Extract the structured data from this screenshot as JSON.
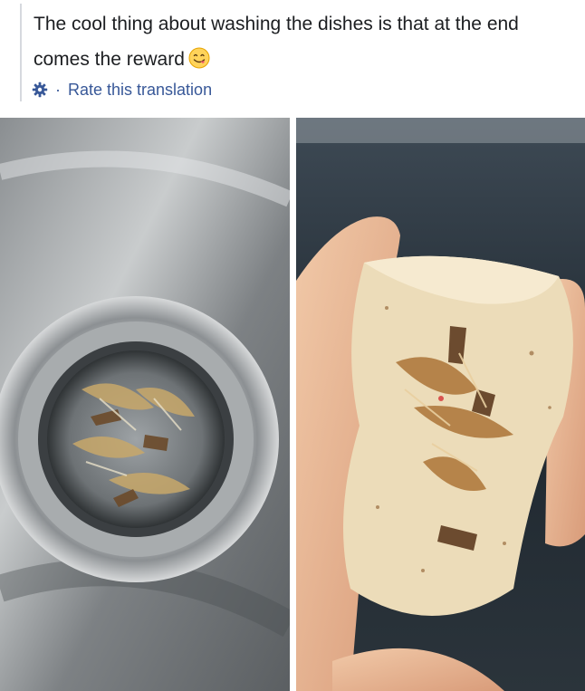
{
  "post": {
    "text": "The cool thing about washing the dishes is that at the end comes the reward",
    "emoji": "yum-face-emoji"
  },
  "translation": {
    "separator": "·",
    "rate_label": "Rate this translation",
    "icon": "gear-icon"
  },
  "colors": {
    "text": "#1c1e21",
    "link": "#385898",
    "quote_bar": "#d6d9de"
  }
}
